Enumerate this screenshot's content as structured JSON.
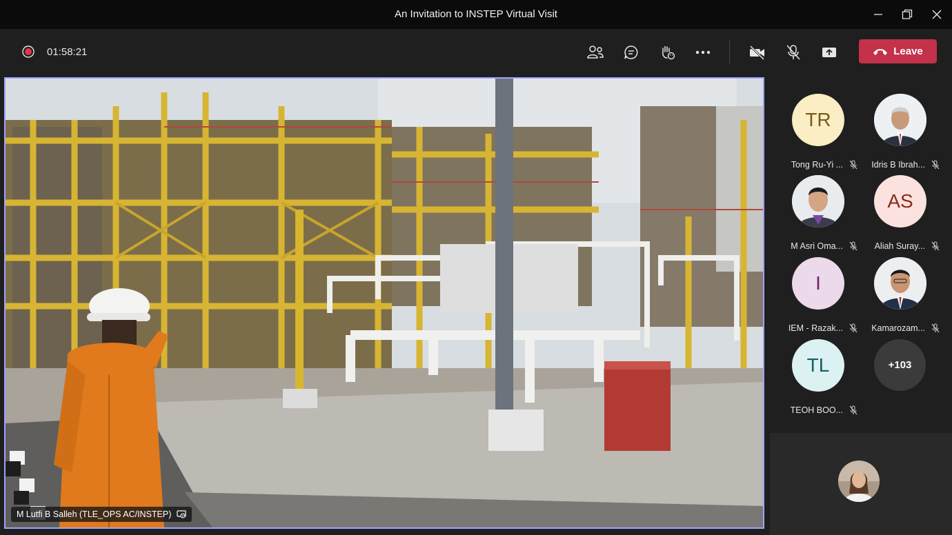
{
  "window": {
    "title": "An Invitation to INSTEP Virtual Visit"
  },
  "toolbar": {
    "timer": "01:58:21",
    "leave_label": "Leave",
    "icons": [
      "record-icon",
      "people-icon",
      "chat-icon",
      "raise-hand-icon",
      "more-icon",
      "camera-off-icon",
      "mic-off-icon",
      "share-icon",
      "phone-icon"
    ]
  },
  "stage": {
    "presenter_name": "M Lutfi B Salleh (TLE_OPS AC/INSTEP)"
  },
  "participants": [
    {
      "initials": "TR",
      "name": "Tong Ru-Yi ...",
      "bg": "#fbedc4",
      "fg": "#7a5a1a",
      "photo": false
    },
    {
      "initials": "",
      "name": "Idris B Ibrah...",
      "bg": "#e6e6e6",
      "fg": "#333333",
      "photo": true
    },
    {
      "initials": "",
      "name": "M Asri Oma...",
      "bg": "#e6e6e6",
      "fg": "#333333",
      "photo": true
    },
    {
      "initials": "AS",
      "name": "Aliah Suray...",
      "bg": "#fbe2de",
      "fg": "#8c2a1f",
      "photo": false
    },
    {
      "initials": "I",
      "name": "IEM - Razak...",
      "bg": "#ecd9ea",
      "fg": "#6b2566",
      "photo": false
    },
    {
      "initials": "",
      "name": "Kamarozam...",
      "bg": "#e6e6e6",
      "fg": "#333333",
      "photo": true
    },
    {
      "initials": "TL",
      "name": "TEOH BOO...",
      "bg": "#dcf1f2",
      "fg": "#145e63",
      "photo": false
    }
  ],
  "overflow_count": "+103",
  "colors": {
    "leave": "#c4314b",
    "active_border": "#9ea2ff",
    "record": "#e0354e"
  }
}
